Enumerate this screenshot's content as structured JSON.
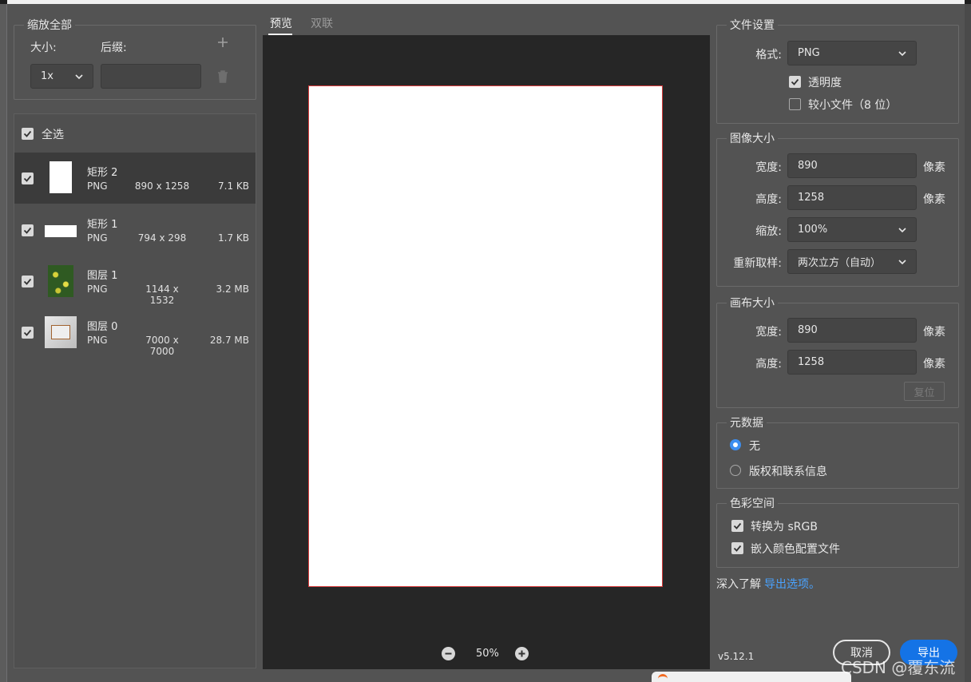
{
  "scale_group": {
    "title": "缩放全部",
    "size_label": "大小:",
    "suffix_label": "后缀:",
    "scale_value": "1x",
    "suffix_value": ""
  },
  "assets": {
    "select_all": "全选",
    "items": [
      {
        "name": "矩形 2",
        "format": "PNG",
        "dimensions": "890 x 1258",
        "size": "7.1 KB"
      },
      {
        "name": "矩形 1",
        "format": "PNG",
        "dimensions": "794 x 298",
        "size": "1.7 KB"
      },
      {
        "name": "图层 1",
        "format": "PNG",
        "dimensions": "1144 x 1532",
        "size": "3.2 MB"
      },
      {
        "name": "图层 0",
        "format": "PNG",
        "dimensions": "7000 x 7000",
        "size": "28.7 MB"
      }
    ]
  },
  "tabs": {
    "preview": "预览",
    "two_up": "双联"
  },
  "zoom": {
    "value": "50%"
  },
  "file_settings": {
    "title": "文件设置",
    "format_label": "格式:",
    "format_value": "PNG",
    "transparency": "透明度",
    "smaller_file": "较小文件（8 位）"
  },
  "image_size": {
    "title": "图像大小",
    "width_label": "宽度:",
    "width_value": "890",
    "height_label": "高度:",
    "height_value": "1258",
    "scale_label": "缩放:",
    "scale_value": "100%",
    "resample_label": "重新取样:",
    "resample_value": "两次立方（自动）",
    "unit": "像素"
  },
  "canvas_size": {
    "title": "画布大小",
    "width_label": "宽度:",
    "width_value": "890",
    "height_label": "高度:",
    "height_value": "1258",
    "unit": "像素",
    "reset": "复位"
  },
  "metadata": {
    "title": "元数据",
    "none": "无",
    "copyright": "版权和联系信息"
  },
  "color_space": {
    "title": "色彩空间",
    "convert": "转换为 sRGB",
    "embed": "嵌入颜色配置文件"
  },
  "learn_more": {
    "prefix": "深入了解",
    "link": "导出选项。"
  },
  "version": "v5.12.1",
  "buttons": {
    "cancel": "取消",
    "export": "导出"
  },
  "watermark": "CSDN @覆东流",
  "colors": {
    "accent": "#1473e6",
    "link": "#4aa3ff",
    "canvas_border": "#d63b3b"
  }
}
